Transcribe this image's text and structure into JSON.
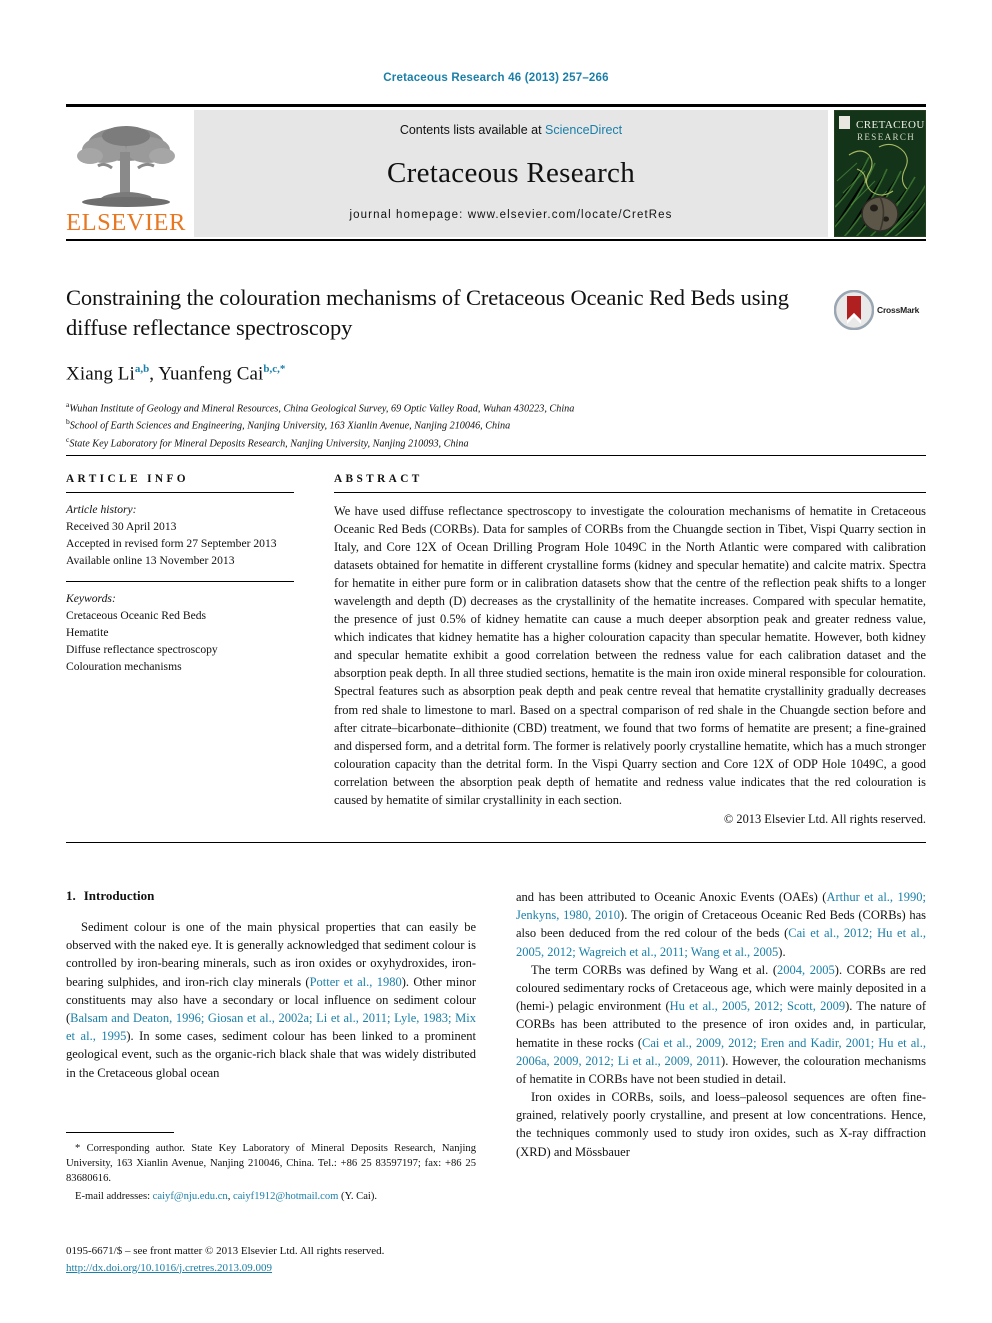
{
  "running_head": "Cretaceous Research 46 (2013) 257–266",
  "masthead": {
    "publisher_logo_text": "ELSEVIER",
    "contents_prefix": "Contents lists available at",
    "contents_link": "ScienceDirect",
    "journal_name": "Cretaceous Research",
    "homepage_line": "journal homepage: www.elsevier.com/locate/CretRes",
    "cover_title_line1": "CRETACEOUS",
    "cover_title_line2": "RESEARCH"
  },
  "article": {
    "title": "Constraining the colouration mechanisms of Cretaceous Oceanic Red Beds using diffuse reflectance spectroscopy",
    "crossmark_label": "CrossMark",
    "authors": [
      {
        "name": "Xiang Li",
        "sup": "a,b",
        "sep": ", "
      },
      {
        "name": "Yuanfeng Cai",
        "sup": "b,c,*",
        "sep": ""
      }
    ],
    "affiliations": [
      {
        "mark": "a",
        "text": "Wuhan Institute of Geology and Mineral Resources, China Geological Survey, 69 Optic Valley Road, Wuhan 430223, China"
      },
      {
        "mark": "b",
        "text": "School of Earth Sciences and Engineering, Nanjing University, 163 Xianlin Avenue, Nanjing 210046, China"
      },
      {
        "mark": "c",
        "text": "State Key Laboratory for Mineral Deposits Research, Nanjing University, Nanjing 210093, China"
      }
    ]
  },
  "article_info": {
    "heading": "ARTICLE INFO",
    "history_label": "Article history:",
    "history": [
      "Received 30 April 2013",
      "Accepted in revised form 27 September 2013",
      "Available online 13 November 2013"
    ],
    "keywords_label": "Keywords:",
    "keywords": [
      "Cretaceous Oceanic Red Beds",
      "Hematite",
      "Diffuse reflectance spectroscopy",
      "Colouration mechanisms"
    ]
  },
  "abstract": {
    "heading": "ABSTRACT",
    "text": "We have used diffuse reflectance spectroscopy to investigate the colouration mechanisms of hematite in Cretaceous Oceanic Red Beds (CORBs). Data for samples of CORBs from the Chuangde section in Tibet, Vispi Quarry section in Italy, and Core 12X of Ocean Drilling Program Hole 1049C in the North Atlantic were compared with calibration datasets obtained for hematite in different crystalline forms (kidney and specular hematite) and calcite matrix. Spectra for hematite in either pure form or in calibration datasets show that the centre of the reflection peak shifts to a longer wavelength and depth (D) decreases as the crystallinity of the hematite increases. Compared with specular hematite, the presence of just 0.5% of kidney hematite can cause a much deeper absorption peak and greater redness value, which indicates that kidney hematite has a higher colouration capacity than specular hematite. However, both kidney and specular hematite exhibit a good correlation between the redness value for each calibration dataset and the absorption peak depth. In all three studied sections, hematite is the main iron oxide mineral responsible for colouration. Spectral features such as absorption peak depth and peak centre reveal that hematite crystallinity gradually decreases from red shale to limestone to marl. Based on a spectral comparison of red shale in the Chuangde section before and after citrate–bicarbonate–dithionite (CBD) treatment, we found that two forms of hematite are present; a fine-grained and dispersed form, and a detrital form. The former is relatively poorly crystalline hematite, which has a much stronger colouration capacity than the detrital form. In the Vispi Quarry section and Core 12X of ODP Hole 1049C, a good correlation between the absorption peak depth of hematite and redness value indicates that the red colouration is caused by hematite of similar crystallinity in each section.",
    "copyright": "© 2013 Elsevier Ltd. All rights reserved."
  },
  "introduction": {
    "number": "1.",
    "heading": "Introduction",
    "left_paragraph_1_a": "Sediment colour is one of the main physical properties that can easily be observed with the naked eye. It is generally acknowledged that sediment colour is controlled by iron-bearing minerals, such as iron oxides or oxyhydroxides, iron-bearing sulphides, and iron-rich clay minerals (",
    "left_ref_1": "Potter et al., 1980",
    "left_paragraph_1_b": "). Other minor constituents may also have a secondary or local influence on sediment colour (",
    "left_ref_2": "Balsam and Deaton, 1996; Giosan et al., 2002a; Li et al., 2011; Lyle, 1983; Mix et al., 1995",
    "left_paragraph_1_c": "). In some cases, sediment colour has been linked to a prominent geological event, such as the organic-rich black shale that was widely distributed in the Cretaceous global ocean",
    "right_paragraph_1_a": "and has been attributed to Oceanic Anoxic Events (OAEs) (",
    "right_ref_1": "Arthur et al., 1990; Jenkyns, 1980, 2010",
    "right_paragraph_1_b": "). The origin of Cretaceous Oceanic Red Beds (CORBs) has also been deduced from the red colour of the beds (",
    "right_ref_2": "Cai et al., 2012; Hu et al., 2005, 2012; Wagreich et al., 2011; Wang et al., 2005",
    "right_paragraph_1_c": ").",
    "right_paragraph_2_a": "The term CORBs was defined by Wang et al. (",
    "right_ref_3": "2004, 2005",
    "right_paragraph_2_b": "). CORBs are red coloured sedimentary rocks of Cretaceous age, which were mainly deposited in a (hemi-) pelagic environment (",
    "right_ref_4": "Hu et al., 2005, 2012; Scott, 2009",
    "right_paragraph_2_c": "). The nature of CORBs has been attributed to the presence of iron oxides and, in particular, hematite in these rocks (",
    "right_ref_5": "Cai et al., 2009, 2012; Eren and Kadir, 2001; Hu et al., 2006a, 2009, 2012; Li et al., 2009, 2011",
    "right_paragraph_2_d": "). However, the colouration mechanisms of hematite in CORBs have not been studied in detail.",
    "right_paragraph_3": "Iron oxides in CORBs, soils, and loess–paleosol sequences are often fine-grained, relatively poorly crystalline, and present at low concentrations. Hence, the techniques commonly used to study iron oxides, such as X-ray diffraction (XRD) and Mössbauer"
  },
  "footnotes": {
    "corresponding_marker": "*",
    "corresponding_text": " Corresponding author. State Key Laboratory of Mineral Deposits Research, Nanjing University, 163 Xianlin Avenue, Nanjing 210046, China. Tel.: +86 25 83597197; fax: +86 25 83680616.",
    "email_label": "E-mail addresses:",
    "email_1": "caiyf@nju.edu.cn",
    "email_sep": ", ",
    "email_2": "caiyf1912@hotmail.com",
    "email_suffix": " (Y. Cai)."
  },
  "footer": {
    "issn_line": "0195-6671/$ – see front matter © 2013 Elsevier Ltd. All rights reserved.",
    "doi": "http://dx.doi.org/10.1016/j.cretres.2013.09.009"
  },
  "colors": {
    "link_blue": "#1a7fa8",
    "elsevier_orange": "#E87722",
    "band_gray": "#e6e6e6"
  }
}
